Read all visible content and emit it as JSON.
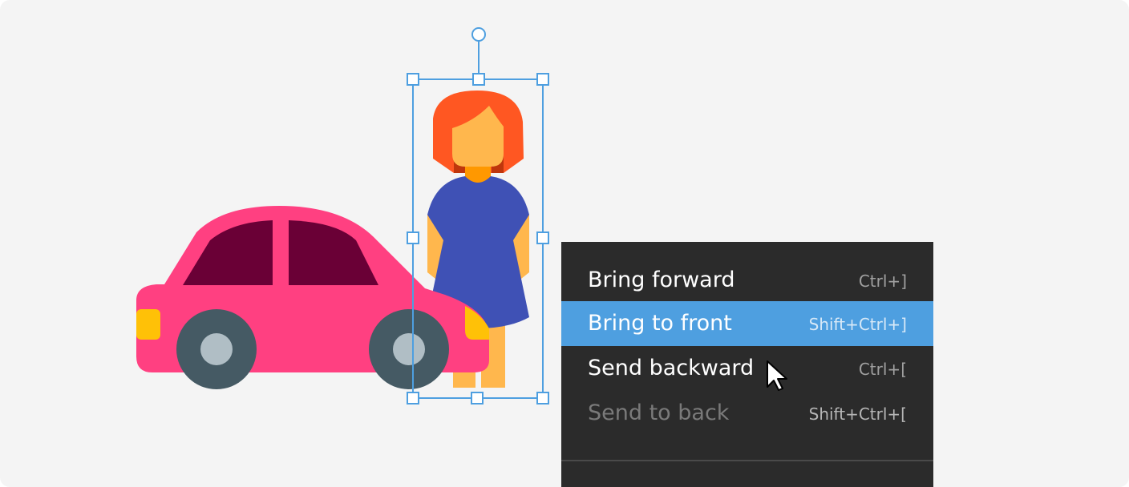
{
  "context_menu": {
    "items": [
      {
        "label": "Bring forward",
        "shortcut": "Ctrl+]",
        "state": "normal"
      },
      {
        "label": "Bring to front",
        "shortcut": "Shift+Ctrl+]",
        "state": "highlighted"
      },
      {
        "label": "Send backward",
        "shortcut": "Ctrl+[",
        "state": "normal"
      },
      {
        "label": "Send to back",
        "shortcut": "Shift+Ctrl+[",
        "state": "disabled"
      }
    ]
  },
  "colors": {
    "canvas_background": "#f4f4f4",
    "selection": "#4e9fe0",
    "menu_background": "#2b2b2b",
    "menu_highlight": "#4e9fe0",
    "car_body": "#ff4081",
    "car_windows": "#6a0036",
    "wheel": "#455a64",
    "hubcap": "#b0bec5",
    "headlight": "#ffc107",
    "hair": "#ff5722",
    "skin": "#ffb74d",
    "dress": "#3f51b5"
  },
  "icons": {
    "car": "car-icon",
    "person": "woman-icon",
    "pointer": "mouse-pointer-icon"
  }
}
